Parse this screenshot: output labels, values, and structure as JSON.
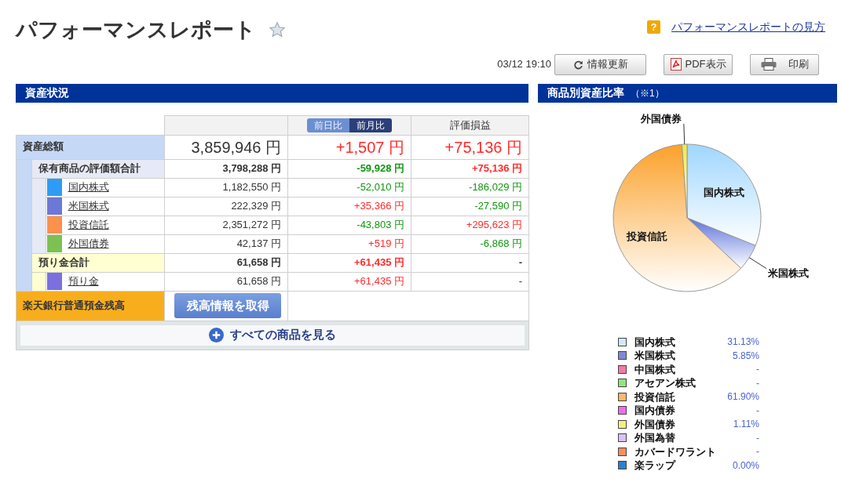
{
  "header": {
    "title": "パフォーマンスレポート",
    "help_icon": "?",
    "help_link": "パフォーマンスレポートの見方"
  },
  "toolbar": {
    "timestamp": "03/12 19:10",
    "buttons": [
      {
        "kind": "refresh",
        "label": "情報更新"
      },
      {
        "kind": "pdf",
        "label": "PDF表示"
      },
      {
        "kind": "print",
        "label": "印刷"
      }
    ]
  },
  "assets": {
    "title": "資産状況",
    "tabs": [
      {
        "label": "前日比",
        "selected": false
      },
      {
        "label": "前月比",
        "selected": true
      }
    ],
    "pl_heading": "評価損益",
    "total": {
      "label": "資産総額",
      "value": "3,859,946 円",
      "change": {
        "text": "+1,507 円",
        "gain": true
      },
      "pl": {
        "text": "+75,136 円",
        "gain": true
      }
    },
    "groups": [
      {
        "kind": "holdings",
        "label": "保有商品の評価額合計",
        "value": "3,798,288 円",
        "change": {
          "text": "-59,928 円",
          "gain": false
        },
        "pl": {
          "text": "+75,136 円",
          "gain": true
        },
        "items": [
          {
            "label": "国内株式",
            "color": "#2e9cf6",
            "value": "1,182,550 円",
            "change": {
              "text": "-52,010 円",
              "gain": false
            },
            "pl": {
              "text": "-186,029 円",
              "gain": false
            }
          },
          {
            "label": "米国株式",
            "color": "#6b78d6",
            "value": "222,329 円",
            "change": {
              "text": "+35,366 円",
              "gain": true
            },
            "pl": {
              "text": "-27,590 円",
              "gain": false
            }
          },
          {
            "label": "投資信託",
            "color": "#fb914a",
            "value": "2,351,272 円",
            "change": {
              "text": "-43,803 円",
              "gain": false
            },
            "pl": {
              "text": "+295,623 円",
              "gain": true
            }
          },
          {
            "label": "外国債券",
            "color": "#7cc152",
            "value": "42,137 円",
            "change": {
              "text": "+519 円",
              "gain": true
            },
            "pl": {
              "text": "-6,868 円",
              "gain": false
            }
          }
        ]
      },
      {
        "kind": "deposits",
        "label": "預り金合計",
        "value": "61,658 円",
        "change": {
          "text": "+61,435 円",
          "gain": true
        },
        "pl": {
          "text": "-"
        },
        "items": [
          {
            "label": "預り金",
            "color": "#7c6fe0",
            "value": "61,658 円",
            "change": {
              "text": "+61,435 円",
              "gain": true
            },
            "pl": {
              "text": "-"
            }
          }
        ]
      }
    ],
    "bank": {
      "label": "楽天銀行普通預金残高",
      "button": "残高情報を取得"
    },
    "more_button": "すべての商品を見る"
  },
  "ratio": {
    "title": "商品別資産比率",
    "note": "（※1）",
    "chart_data": {
      "type": "pie",
      "categories": [
        "国内株式",
        "米国株式",
        "投資信託",
        "外国債券"
      ],
      "values": [
        31.13,
        5.85,
        61.9,
        1.11
      ]
    },
    "legend": [
      {
        "label": "国内株式",
        "color": "#cfe9ff",
        "value": "31.13%"
      },
      {
        "label": "米国株式",
        "color": "#7f88d6",
        "value": "5.85%"
      },
      {
        "label": "中国株式",
        "color": "#f27aa6",
        "value": "-"
      },
      {
        "label": "アセアン株式",
        "color": "#8fe57e",
        "value": "-"
      },
      {
        "label": "投資信託",
        "color": "#ffb96a",
        "value": "61.90%"
      },
      {
        "label": "国内債券",
        "color": "#ee6df0",
        "value": "-"
      },
      {
        "label": "外国債券",
        "color": "#f6f07a",
        "value": "1.11%"
      },
      {
        "label": "外国為替",
        "color": "#dcc0f8",
        "value": "-"
      },
      {
        "label": "カバードワラント",
        "color": "#f7905e",
        "value": "-"
      },
      {
        "label": "楽ラップ",
        "color": "#2e7fd0",
        "value": "0.00%"
      }
    ]
  }
}
